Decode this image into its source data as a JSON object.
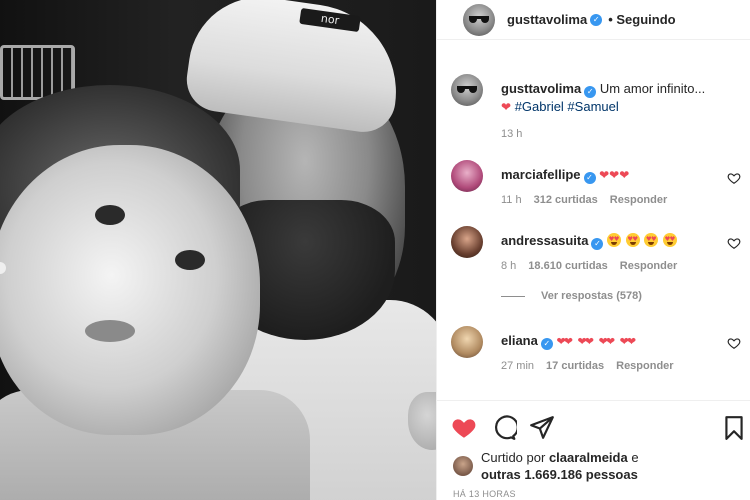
{
  "post": {
    "author": "gusttavolima",
    "follow_status": "Seguindo",
    "caption_text": "Um amor infinito...",
    "caption_hashtags": "#Gabriel #Samuel",
    "caption_time": "13 h",
    "beanie_text": "nor"
  },
  "comments": [
    {
      "user": "marciafellipe",
      "emoji": "❤❤❤",
      "time": "11 h",
      "likes": "312 curtidas",
      "reply": "Responder"
    },
    {
      "user": "andressasuita",
      "time": "8 h",
      "likes": "18.610 curtidas",
      "reply": "Responder",
      "view_replies": "Ver respostas (578)"
    },
    {
      "user": "eliana",
      "time": "27 min",
      "likes": "17 curtidas",
      "reply": "Responder"
    }
  ],
  "likes": {
    "prefix": "Curtido por",
    "user": "claaralmeida",
    "suffix": "e",
    "others": "outras 1.669.186 pessoas"
  },
  "timestamp": "HÁ 13 HORAS",
  "icons": [
    "heart-filled-icon",
    "comment-icon",
    "share-icon",
    "bookmark-icon",
    "verified-icon",
    "small-heart-icon"
  ],
  "colors": {
    "like_red": "#ed4956",
    "verified_blue": "#3897f0",
    "hashtag_blue": "#003569",
    "meta_gray": "#8e8e8e"
  }
}
